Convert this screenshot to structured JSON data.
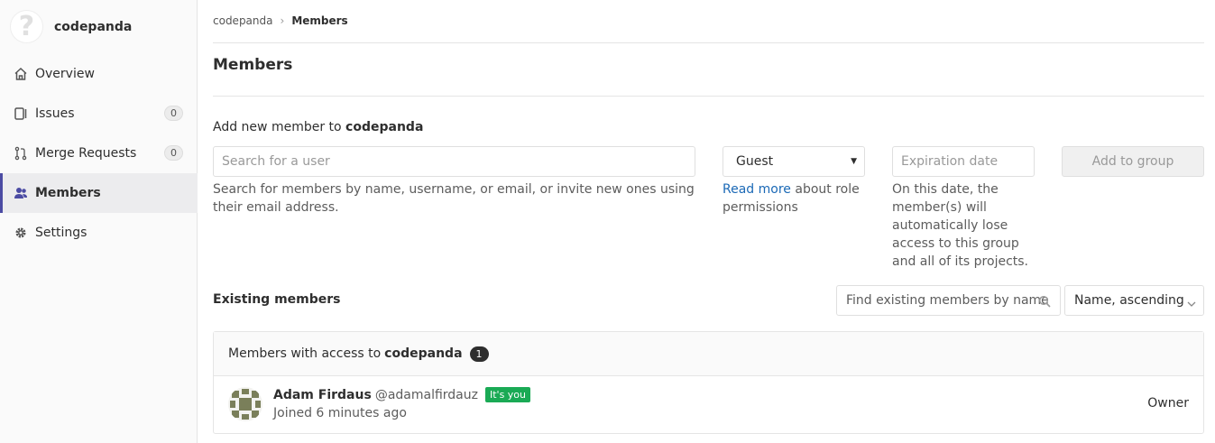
{
  "sidebar": {
    "group_name": "codepanda",
    "items": [
      {
        "label": "Overview",
        "icon": "home-icon"
      },
      {
        "label": "Issues",
        "icon": "issues-icon",
        "count": "0"
      },
      {
        "label": "Merge Requests",
        "icon": "merge-request-icon",
        "count": "0"
      },
      {
        "label": "Members",
        "icon": "users-icon",
        "active": true
      },
      {
        "label": "Settings",
        "icon": "gear-icon"
      }
    ]
  },
  "breadcrumb": {
    "group": "codepanda",
    "current": "Members"
  },
  "page_title": "Members",
  "add_member": {
    "heading_prefix": "Add new member to",
    "heading_group": "codepanda",
    "search_placeholder": "Search for a user",
    "search_help": "Search for members by name, username, or email, or invite new ones using their email address.",
    "role_value": "Guest",
    "role_help_link": "Read more",
    "role_help_text": "about role permissions",
    "expiration_placeholder": "Expiration date",
    "expiration_help": "On this date, the member(s) will automatically lose access to this group and all of its projects.",
    "submit_label": "Add to group"
  },
  "existing": {
    "title": "Existing members",
    "search_placeholder": "Find existing members by name",
    "sort_value": "Name, ascending",
    "panel_prefix": "Members with access to",
    "panel_group": "codepanda",
    "count": "1",
    "members": [
      {
        "name": "Adam Firdaus",
        "username": "@adamalfirdauz",
        "badge": "It's you",
        "joined": "Joined 6 minutes ago",
        "role": "Owner"
      }
    ]
  },
  "colors": {
    "accent": "#4b4ba3",
    "link": "#1b69b6",
    "success": "#1aaa55"
  }
}
